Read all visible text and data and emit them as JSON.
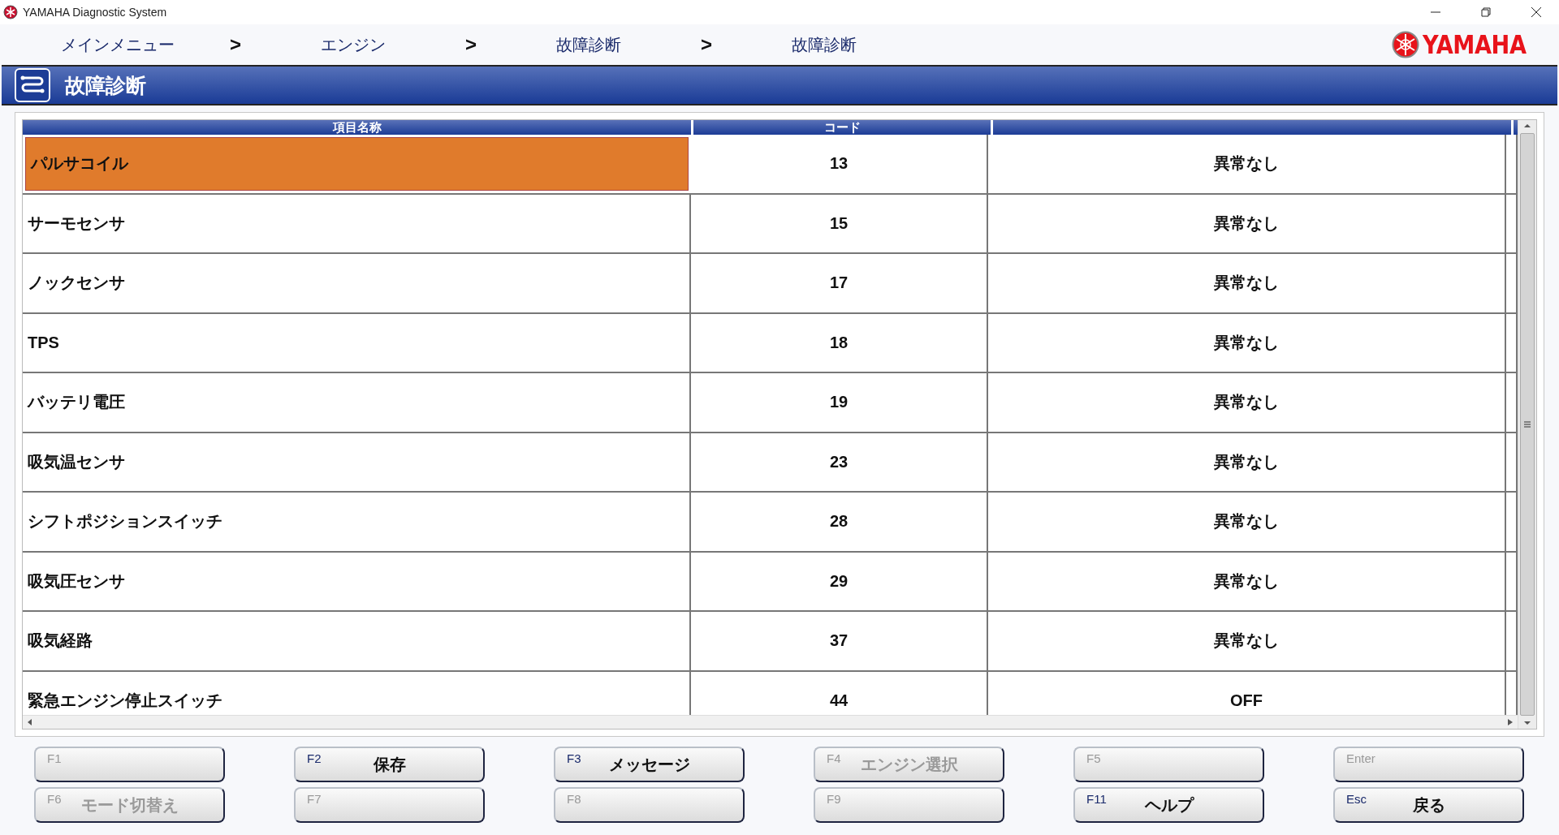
{
  "window": {
    "title": "YAMAHA Diagnostic System"
  },
  "breadcrumb": {
    "items": [
      "メインメニュー",
      "エンジン",
      "故障診断",
      "故障診断"
    ],
    "separator": ">"
  },
  "logo": {
    "text": "YAMAHA"
  },
  "header": {
    "title": "故障診断"
  },
  "table": {
    "columns": [
      "項目名称",
      "コード",
      ""
    ],
    "rows": [
      {
        "name": "パルサコイル",
        "code": "13",
        "result": "異常なし",
        "selected": true
      },
      {
        "name": "サーモセンサ",
        "code": "15",
        "result": "異常なし",
        "selected": false
      },
      {
        "name": "ノックセンサ",
        "code": "17",
        "result": "異常なし",
        "selected": false
      },
      {
        "name": "TPS",
        "code": "18",
        "result": "異常なし",
        "selected": false
      },
      {
        "name": "バッテリ電圧",
        "code": "19",
        "result": "異常なし",
        "selected": false
      },
      {
        "name": "吸気温センサ",
        "code": "23",
        "result": "異常なし",
        "selected": false
      },
      {
        "name": "シフトポジションスイッチ",
        "code": "28",
        "result": "異常なし",
        "selected": false
      },
      {
        "name": "吸気圧センサ",
        "code": "29",
        "result": "異常なし",
        "selected": false
      },
      {
        "name": "吸気経路",
        "code": "37",
        "result": "異常なし",
        "selected": false
      },
      {
        "name": "緊急エンジン停止スイッチ",
        "code": "44",
        "result": "OFF",
        "selected": false
      }
    ]
  },
  "function_keys": [
    {
      "key": "F1",
      "disabled": true
    },
    {
      "key": "F2",
      "label": "保存",
      "disabled": false
    },
    {
      "key": "F3",
      "label": "メッセージ",
      "disabled": false
    },
    {
      "key": "F4",
      "label": "エンジン選択",
      "disabled": true
    },
    {
      "key": "F5",
      "disabled": true
    },
    {
      "key": "Enter",
      "disabled": true
    },
    {
      "key": "F6",
      "label": "モード切替え",
      "disabled": true
    },
    {
      "key": "F7",
      "disabled": true
    },
    {
      "key": "F8",
      "disabled": true
    },
    {
      "key": "F9",
      "disabled": true
    },
    {
      "key": "F11",
      "label": "ヘルプ",
      "disabled": false
    },
    {
      "key": "Esc",
      "label": "戻る",
      "disabled": false
    }
  ]
}
